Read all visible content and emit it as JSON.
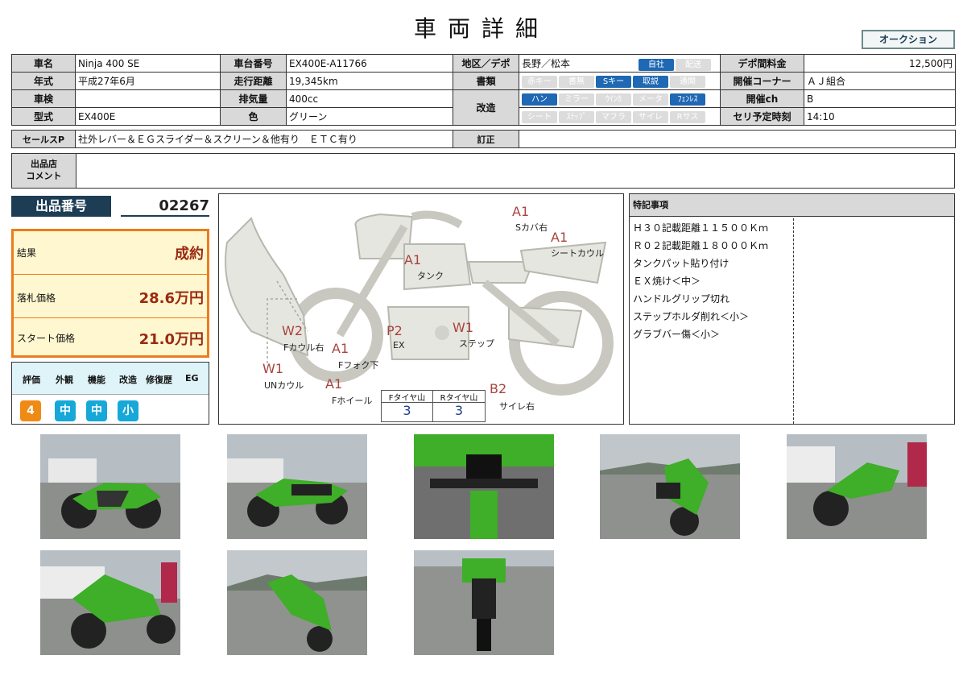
{
  "header": {
    "title": "車両詳細",
    "auction_button": "オークション"
  },
  "spec": {
    "name_label": "車名",
    "name_value": "Ninja 400 SE",
    "frame_label": "車台番号",
    "frame_value": "EX400E-A11766",
    "region_label": "地区／デポ",
    "region_value": "長野／松本",
    "region_tags": [
      "自社",
      "配送"
    ],
    "depot_fee_label": "デポ間料金",
    "depot_fee_value": "12,500円",
    "year_label": "年式",
    "year_value": "平成27年6月",
    "mileage_label": "走行距離",
    "mileage_value": "19,345km",
    "docs_label": "書類",
    "docs_tags": [
      "赤キー",
      "書無",
      "Sキー",
      "取説",
      "通関"
    ],
    "corner_label": "開催コーナー",
    "corner_value": "ＡＪ組合",
    "inspection_label": "車検",
    "inspection_value": "",
    "displacement_label": "排気量",
    "displacement_value": "400cc",
    "mod_label": "改造",
    "mod_tags_row1": [
      "ハン",
      "ミラー",
      "ｳｲﾝｶ",
      "メータ",
      "ﾌｪﾝﾚｽ"
    ],
    "mod_tags_row2": [
      "シート",
      "ｽﾃｯﾌﾟ",
      "マフラ",
      "サイレ",
      "Rサス"
    ],
    "channel_label": "開催ch",
    "channel_value": "B",
    "model_label": "型式",
    "model_value": "EX400E",
    "color_label": "色",
    "color_value": "グリーン",
    "time_label": "セリ予定時刻",
    "time_value": "14:10",
    "sales_label": "セールスP",
    "sales_value": "社外レバー＆ＥＧスライダー＆スクリーン＆他有り　ＥＴＣ有り",
    "correction_label": "訂正",
    "correction_value": "",
    "comment_label_1": "出品店",
    "comment_label_2": "コメント",
    "comment_value": ""
  },
  "lot": {
    "label": "出品番号",
    "number": "02267"
  },
  "result": {
    "result_label": "結果",
    "result_value": "成約",
    "bid_label": "落札価格",
    "bid_value": "28.6万円",
    "start_label": "スタート価格",
    "start_value": "21.0万円"
  },
  "grade": {
    "headers": [
      "評価",
      "外観",
      "機能",
      "改造",
      "修復歴",
      "EG"
    ],
    "overall": "4",
    "exterior": "中",
    "function": "中",
    "modification": "小"
  },
  "diagram": {
    "marks": [
      {
        "code": "A1",
        "label": "Sカバ右"
      },
      {
        "code": "A1",
        "label": "シートカウル"
      },
      {
        "code": "A1",
        "label": "タンク"
      },
      {
        "code": "W2",
        "label": "Fカウル右"
      },
      {
        "code": "A1",
        "label": "Fフォク下"
      },
      {
        "code": "P2",
        "label": "EX"
      },
      {
        "code": "W1",
        "label": "ステップ"
      },
      {
        "code": "W1",
        "label": "UNカウル"
      },
      {
        "code": "A1",
        "label": "Fホイール"
      },
      {
        "code": "B2",
        "label": "サイレ右"
      }
    ],
    "tire_f_label": "Fタイヤ山",
    "tire_f_value": "3",
    "tire_r_label": "Rタイヤ山",
    "tire_r_value": "3"
  },
  "notes": {
    "title": "特記事項",
    "lines": [
      "Ｈ３０記載距離１１５００Ｋｍ",
      "Ｒ０２記載距離１８０００Ｋｍ",
      "タンクパット貼り付け",
      "ＥＸ焼け＜中＞",
      "ハンドルグリップ切れ",
      "ステップホルダ削れ＜小＞",
      "グラブバー傷＜小＞"
    ]
  },
  "colors": {
    "navy": "#1d3d55",
    "orange": "#ec7c1c",
    "blue_tag": "#1f68b3",
    "price": "#9b2a12",
    "kawasaki_green": "#3fae28"
  }
}
